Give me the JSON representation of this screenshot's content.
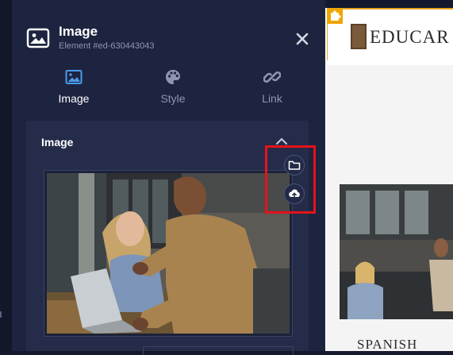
{
  "panel": {
    "title": "Image",
    "subtitle": "Element #ed-630443043",
    "close_icon": "close-icon"
  },
  "tabs": [
    {
      "label": "Image",
      "icon": "image-icon",
      "active": true
    },
    {
      "label": "Style",
      "icon": "palette-icon",
      "active": false
    },
    {
      "label": "Link",
      "icon": "link-icon",
      "active": false
    }
  ],
  "section": {
    "title": "Image",
    "actions": [
      {
        "name": "select-from-library",
        "icon": "folder-icon"
      },
      {
        "name": "upload",
        "icon": "upload-icon"
      }
    ]
  },
  "colors": {
    "panel_bg": "#1d2440",
    "section_bg": "#242c4a",
    "accent_blue": "#4a9be8",
    "highlight_red": "#e5131a",
    "badge_orange": "#f0a500"
  },
  "preview": {
    "logo_text": "EDUCAR",
    "banner_text": "SPANISH"
  }
}
